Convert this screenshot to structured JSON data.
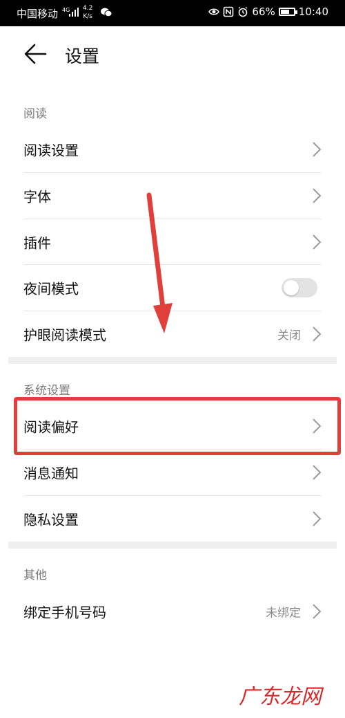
{
  "status_bar": {
    "carrier": "中国移动",
    "network": "4G",
    "speed_top": "4.2",
    "speed_bottom": "K/s",
    "battery": "66%",
    "battery_level": 0.66,
    "time": "10:40"
  },
  "header": {
    "title": "设置"
  },
  "sections": {
    "reading": {
      "label": "阅读",
      "items": [
        {
          "label": "阅读设置"
        },
        {
          "label": "字体"
        },
        {
          "label": "插件"
        },
        {
          "label": "夜间模式",
          "toggle_on": false
        },
        {
          "label": "护眼阅读模式",
          "value": "关闭"
        }
      ]
    },
    "system": {
      "label": "系统设置",
      "items": [
        {
          "label": "阅读偏好"
        },
        {
          "label": "消息通知"
        },
        {
          "label": "隐私设置"
        }
      ]
    },
    "other": {
      "label": "其他",
      "items": [
        {
          "label": "绑定手机号码",
          "value": "未绑定"
        }
      ]
    }
  },
  "watermark": "广东龙网",
  "colors": {
    "annotation_red": "#e0403c",
    "status_bar": "#000000",
    "secondary_text": "#8a8a8a"
  }
}
